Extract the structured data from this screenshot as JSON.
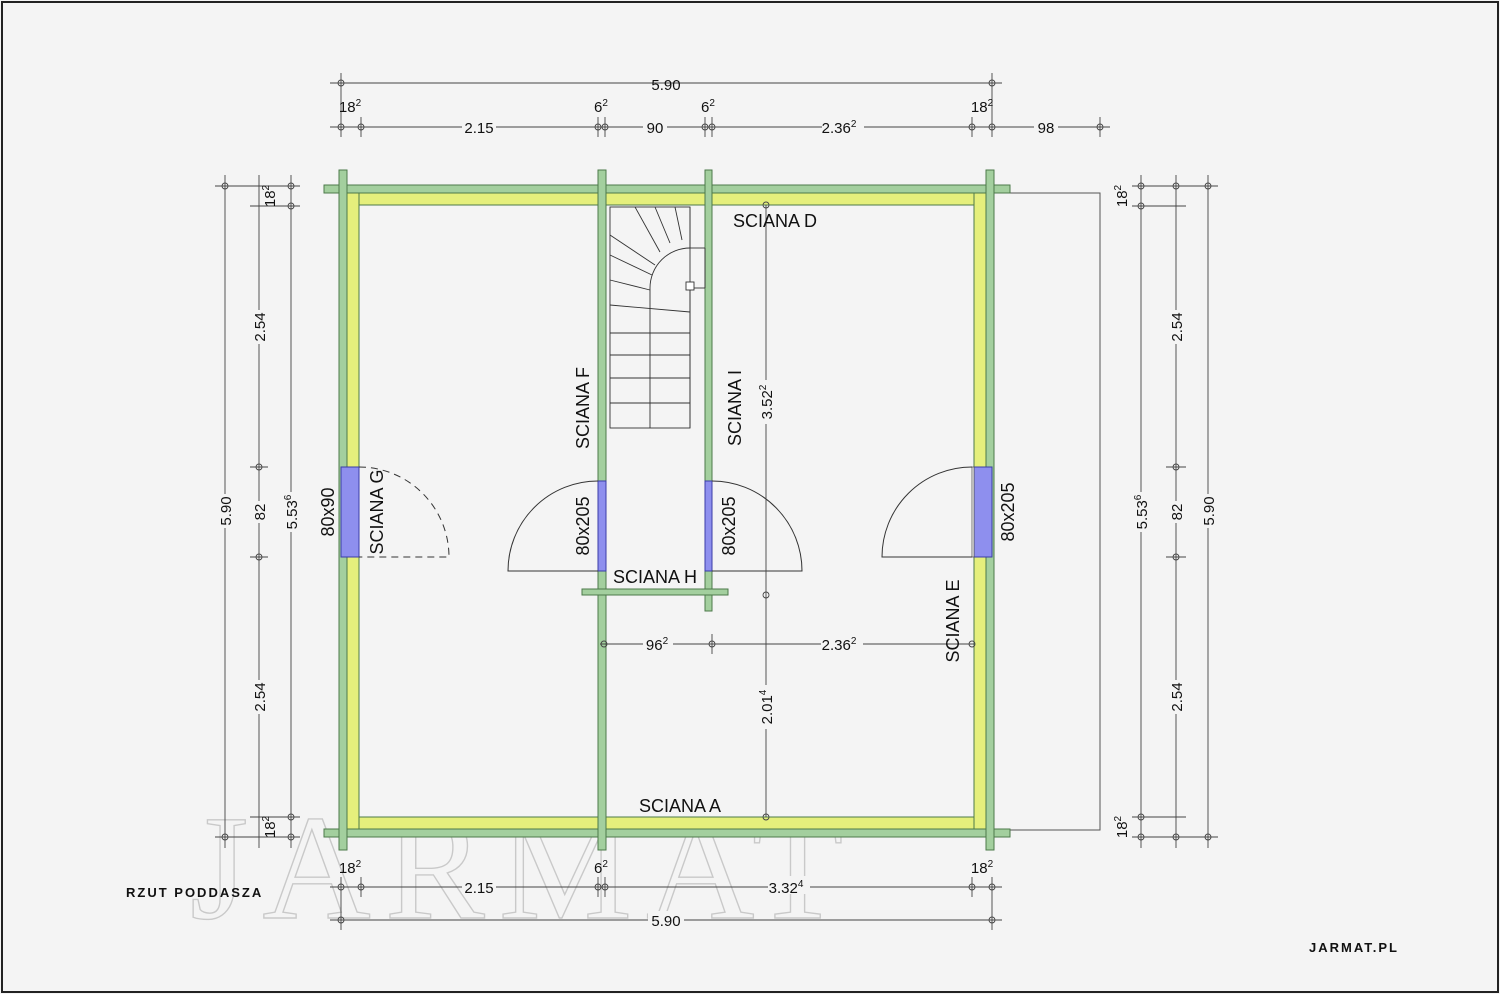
{
  "watermark": "JARMAT",
  "caption_left": "RZUT PODDASZA",
  "caption_right": "JARMAT.PL",
  "colors": {
    "wall": "#a3cf9e",
    "insulation": "#e5ef7c",
    "opening": "#8e8fee",
    "background": "#f4f4f4"
  },
  "walls": {
    "a": "SCIANA A",
    "d": "SCIANA D",
    "e": "SCIANA E",
    "f": "SCIANA F",
    "g": "SCIANA G",
    "h": "SCIANA H",
    "i": "SCIANA I"
  },
  "openings": {
    "left": "80x90",
    "inner_left": "80x205",
    "inner_right": "80x205",
    "right": "80x205"
  },
  "dims_top": {
    "total": "5.90",
    "seg1": "18",
    "seg1_sup": "2",
    "seg2": "2.15",
    "seg3": "6",
    "seg3_sup": "2",
    "seg4": "90",
    "seg5": "6",
    "seg5_sup": "2",
    "seg6": "2.36",
    "seg6_sup": "2",
    "seg7": "18",
    "seg7_sup": "2",
    "seg8": "98"
  },
  "dims_bottom": {
    "seg1": "18",
    "seg1_sup": "2",
    "seg2": "2.15",
    "seg3": "6",
    "seg3_sup": "2",
    "seg4": "3.32",
    "seg4_sup": "4",
    "seg5": "18",
    "seg5_sup": "2",
    "total": "5.90"
  },
  "dims_left": {
    "total": "5.90",
    "top_wall": "18",
    "top_wall_sup": "2",
    "upper": "2.54",
    "door": "82",
    "lower": "2.54",
    "bottom_wall": "18",
    "bottom_wall_sup": "2",
    "inner": "5.53",
    "inner_sup": "6"
  },
  "dims_right": {
    "total": "5.90",
    "top_wall": "18",
    "top_wall_sup": "2",
    "upper": "2.54",
    "door": "82",
    "lower": "2.54",
    "bottom_wall": "18",
    "bottom_wall_sup": "2",
    "inner": "5.53",
    "inner_sup": "6"
  },
  "dims_inner": {
    "stair_height": "3.52",
    "stair_height_sup": "2",
    "lower_height": "2.01",
    "lower_height_sup": "4",
    "corridor": "96",
    "corridor_sup": "2",
    "room_width": "2.36",
    "room_width_sup": "2"
  }
}
